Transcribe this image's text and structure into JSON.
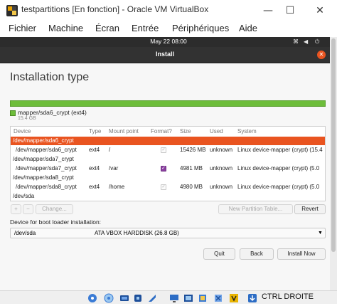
{
  "window": {
    "title": "testpartitions [En fonction] - Oracle VM VirtualBox",
    "minimize_icon": "minimize-icon",
    "maximize_icon": "maximize-icon",
    "close_icon": "close-icon"
  },
  "menu": {
    "items": [
      "Fichier",
      "Machine",
      "Écran",
      "Entrée",
      "Périphériques",
      "Aide"
    ]
  },
  "guest_topbar": {
    "clock": "May 22  08:00"
  },
  "installer": {
    "window_title": "Install",
    "section_title": "Installation type",
    "disk_legend": {
      "name": "mapper/sda6_crypt (ext4)",
      "size": "15.4 GB",
      "color": "#6dbd3a"
    },
    "table": {
      "headers": [
        "Device",
        "Type",
        "Mount point",
        "Format?",
        "Size",
        "Used",
        "System"
      ],
      "rows": [
        {
          "kind": "group",
          "device": "/dev/mapper/sda6_crypt",
          "selected": true
        },
        {
          "kind": "part",
          "device": "/dev/mapper/sda6_crypt",
          "type": "ext4",
          "mount": "/",
          "format": false,
          "size": "15426 MB",
          "used": "unknown",
          "system": "Linux device-mapper (crypt) (15.4"
        },
        {
          "kind": "group",
          "device": "/dev/mapper/sda7_crypt",
          "selected": false
        },
        {
          "kind": "part",
          "device": "/dev/mapper/sda7_crypt",
          "type": "ext4",
          "mount": "/var",
          "format": true,
          "size": "4981 MB",
          "used": "unknown",
          "system": "Linux device-mapper (crypt) (5.0"
        },
        {
          "kind": "group",
          "device": "/dev/mapper/sda8_crypt",
          "selected": false
        },
        {
          "kind": "part",
          "device": "/dev/mapper/sda8_crypt",
          "type": "ext4",
          "mount": "/home",
          "format": false,
          "size": "4980 MB",
          "used": "unknown",
          "system": "Linux device-mapper (crypt) (5.0"
        },
        {
          "kind": "group",
          "device": "/dev/sda",
          "selected": false
        }
      ]
    },
    "buttons": {
      "add": "+",
      "remove": "−",
      "change": "Change...",
      "new_table": "New Partition Table...",
      "revert": "Revert",
      "quit": "Quit",
      "back": "Back",
      "install_now": "Install Now"
    },
    "boot_loader": {
      "label": "Device for boot loader installation:",
      "device": "/dev/sda",
      "description": "ATA VBOX HARDDISK (26.8 GB)"
    },
    "accent_color": "#e95420"
  },
  "statusbar": {
    "host_key": "CTRL DROITE",
    "icons": [
      "optical-drive-icon",
      "audio-icon",
      "network-icon",
      "usb-icon",
      "shared-folders-icon",
      "display-icon",
      "recording-icon",
      "mouse-integration-icon",
      "cpu-icon",
      "keyboard-icon"
    ]
  }
}
